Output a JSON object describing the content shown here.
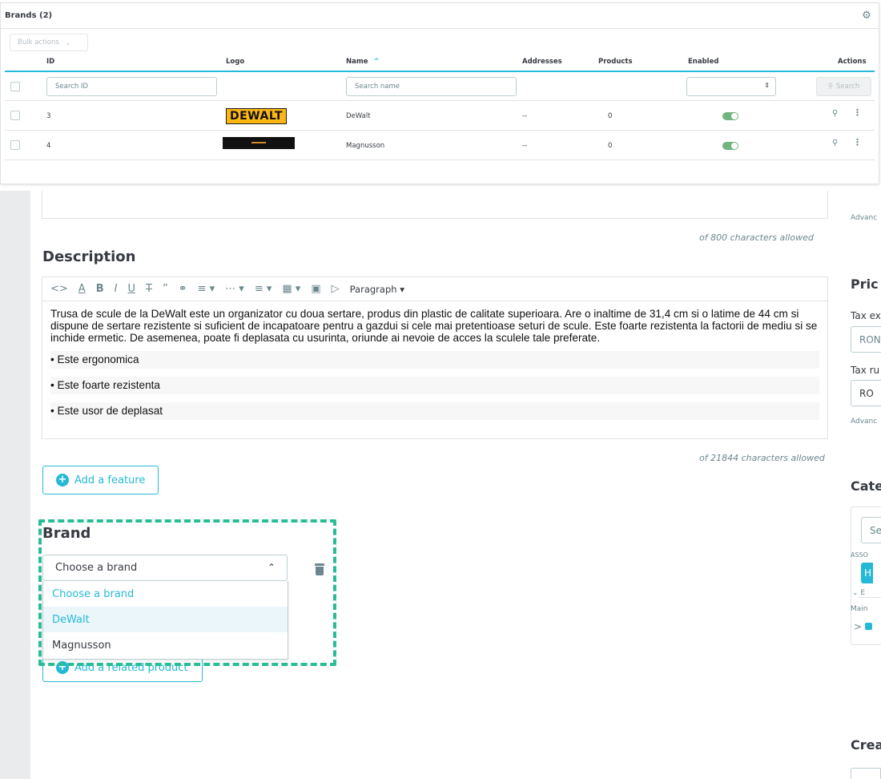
{
  "brands_panel": {
    "title": "Brands (2)",
    "bulk_label": "Bulk actions",
    "columns": [
      "ID",
      "Logo",
      "Name",
      "Addresses",
      "Products",
      "Enabled",
      "Actions"
    ],
    "name_sort_indicator": "^",
    "filters": {
      "id_placeholder": "Search ID",
      "name_placeholder": "Search name",
      "search_label": "Search"
    },
    "rows": [
      {
        "id": "3",
        "logo_text": "DEWALT",
        "name": "DeWalt",
        "addresses": "--",
        "products": "0",
        "enabled": true
      },
      {
        "id": "4",
        "logo_text": "",
        "name": "Magnusson",
        "addresses": "--",
        "products": "0",
        "enabled": true
      }
    ]
  },
  "form": {
    "meta_count": "of 800 characters allowed",
    "description_title": "Description",
    "toolbar": {
      "paragraph_label": "Paragraph"
    },
    "description_paragraph": "Trusa de scule de la DeWalt este un organizator cu doua sertare, produs din plastic de calitate superioara. Are o inaltime de 31,4 cm si o latime de 44 cm si dispune de sertare rezistente si suficient de incapatoare pentru a gazdui si cele mai pretentioase seturi de scule. Este foarte rezistenta la factorii de mediu si se inchide ermetic. De asemenea, poate fi deplasata cu usurinta, oriunde ai nevoie de acces la sculele tale preferate.",
    "bullets": [
      "• Este ergonomica",
      "• Este foarte rezistenta",
      "• Este usor de deplasat"
    ],
    "description_count": "of 21844 characters allowed",
    "add_feature_label": "Add a feature",
    "brand_title": "Brand",
    "brand_selected": "Choose a brand",
    "brand_options": [
      "Choose a brand",
      "DeWalt",
      "Magnusson"
    ],
    "add_related_label": "Add a related product"
  },
  "right_column": {
    "advanced_1": "Advanc",
    "price_title": "Pric",
    "tax_excl_label": "Tax ex",
    "currency_1": "RON",
    "tax_rule_label": "Tax ru",
    "tax_rule_value": "RO",
    "advanced_2": "Advanc",
    "categories_title": "Cate",
    "cat_search": "Se",
    "assoc_label": "ASSO",
    "cat_tag": "H",
    "expand_label": "E",
    "main_label": "Main",
    "create_title": "Crea"
  },
  "colors": {
    "accent": "#25b9d7",
    "enabled_green": "#70b580",
    "dashed_highlight": "#29bd96"
  }
}
